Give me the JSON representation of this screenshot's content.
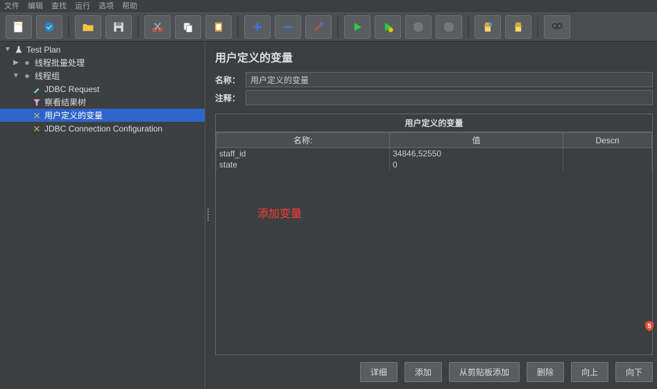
{
  "menu": {
    "file": "文件",
    "edit": "编辑",
    "search": "查找",
    "run": "运行",
    "options": "选项",
    "help": "帮助"
  },
  "tree": {
    "items": [
      {
        "label": "Test Plan"
      },
      {
        "label": "线程批量处理"
      },
      {
        "label": "线程组"
      },
      {
        "label": "JDBC Request"
      },
      {
        "label": "察看结果树"
      },
      {
        "label": "用户定义的变量"
      },
      {
        "label": "JDBC Connection Configuration"
      }
    ]
  },
  "panel": {
    "title": "用户定义的变量",
    "name_label": "名称：",
    "name_value": "用户定义的变量",
    "comment_label": "注释：",
    "comment_value": "",
    "table_caption": "用户定义的变量",
    "headers": {
      "name": "名称:",
      "value": "值",
      "desc": "Descri"
    },
    "rows": [
      {
        "name": "staff_id",
        "value": "34846,52550"
      },
      {
        "name": "state",
        "value": "0"
      }
    ],
    "annotation": "添加变量"
  },
  "buttons": {
    "detail": "详细",
    "add": "添加",
    "paste": "从剪贴板添加",
    "delete": "删除",
    "up": "向上",
    "down": "向下"
  }
}
